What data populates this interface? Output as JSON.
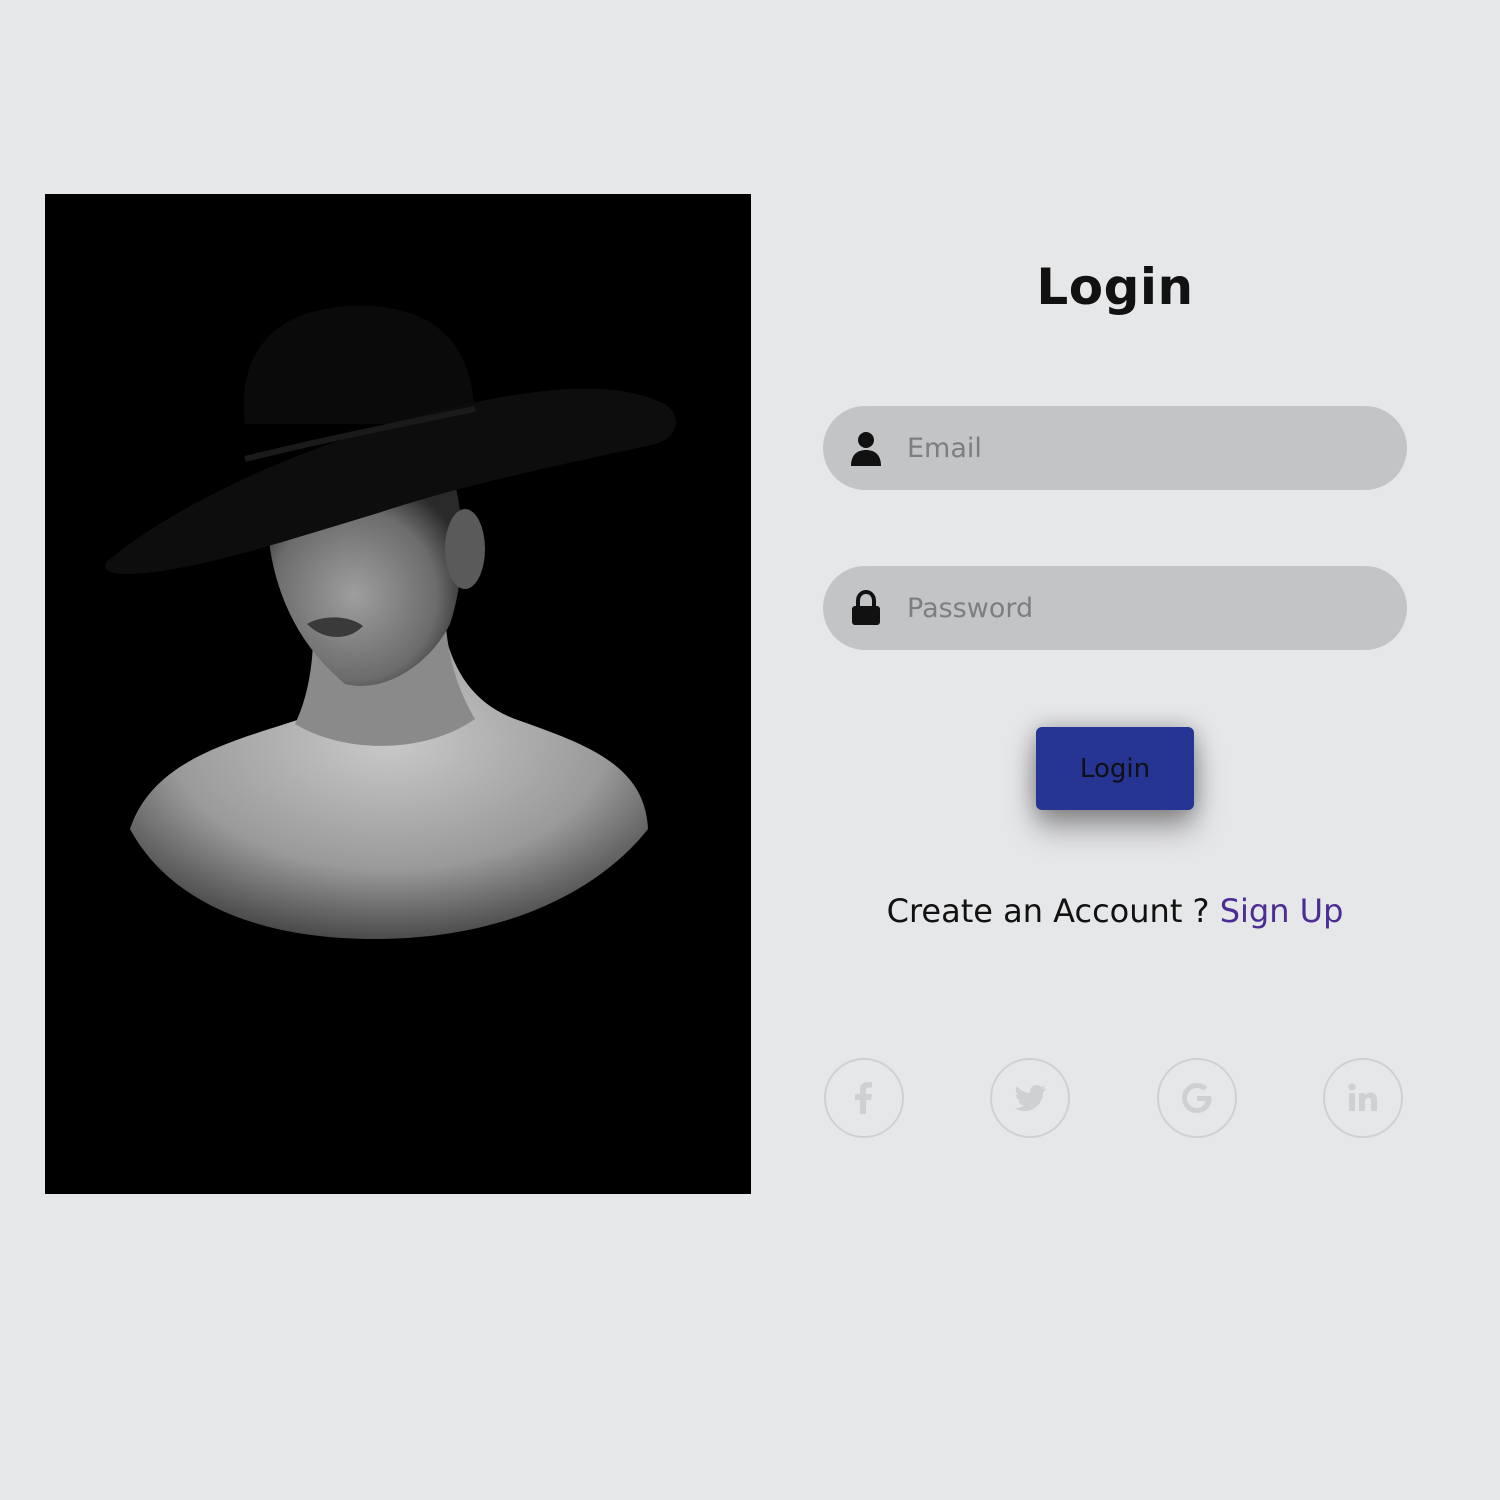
{
  "login": {
    "title": "Login",
    "email_placeholder": "Email",
    "password_placeholder": "Password",
    "button_label": "Login"
  },
  "signup": {
    "prompt": "Create an Account ? ",
    "link_label": "Sign Up"
  },
  "social": {
    "icons": [
      "facebook-icon",
      "twitter-icon",
      "google-icon",
      "linkedin-icon"
    ]
  },
  "colors": {
    "background": "#e6e7e9",
    "field": "#c3c4c6",
    "button": "#263593",
    "link": "#4b2d93"
  }
}
